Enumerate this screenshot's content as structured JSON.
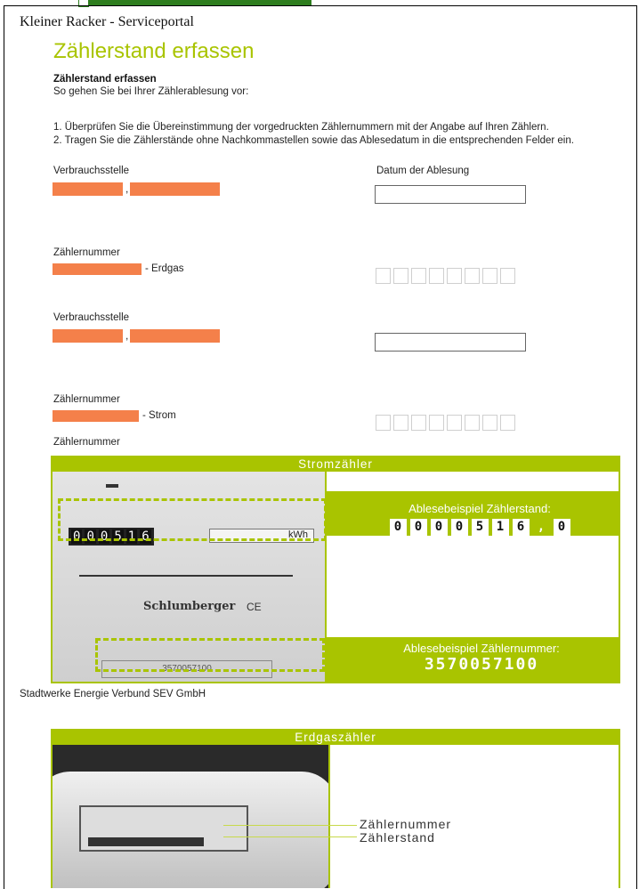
{
  "header": {
    "portal_title": "Kleiner Racker - Serviceportal"
  },
  "page": {
    "heading": "Zählerstand erfassen",
    "sub_heading": "Zählerstand erfassen",
    "intro": "So gehen Sie bei Ihrer Zählerablesung vor:",
    "steps": [
      "1. Überprüfen Sie die Übereinstimmung der vorgedruckten Zählernummern mit der Angabe auf Ihren Zählern.",
      "2. Tragen Sie die Zählerstände ohne Nachkommastellen sowie das Ablesedatum in die entsprechenden Felder ein."
    ]
  },
  "form": {
    "gas": {
      "verbrauchsstelle_label": "Verbrauchsstelle",
      "datum_label": "Datum der Ablesung",
      "zaehlernummer_label": "Zählernummer",
      "type_suffix": "- Erdgas",
      "digit_count": 8
    },
    "strom": {
      "verbrauchsstelle_label": "Verbrauchsstelle",
      "zaehlernummer_label": "Zählernummer",
      "type_suffix": "- Strom",
      "digit_count": 8
    },
    "zaehlernummer_label_extra": "Zählernummer",
    "redaction_color": "#f4804a",
    "accent_color": "#a9c400"
  },
  "strom_panel": {
    "title": "Stromzähler",
    "counter_digits": [
      "0",
      "0",
      "0",
      "5",
      "1",
      "6"
    ],
    "unit": "kWh",
    "brand": "Schlumberger",
    "ce_mark": "CE",
    "serial_on_meter": "3570057100",
    "reading_example_label": "Ablesebeispiel Zählerstand:",
    "reading_example_digits": [
      "0",
      "0",
      "0",
      "0",
      "5",
      "1",
      "6",
      ",",
      "0"
    ],
    "number_example_label": "Ablesebeispiel Zählernummer:",
    "number_example_value": "3570057100"
  },
  "footer": {
    "company": "Stadtwerke Energie Verbund SEV GmbH"
  },
  "gas_panel": {
    "title": "Erdgaszähler",
    "label_number": "Zählernummer",
    "label_reading": "Zählerstand"
  }
}
